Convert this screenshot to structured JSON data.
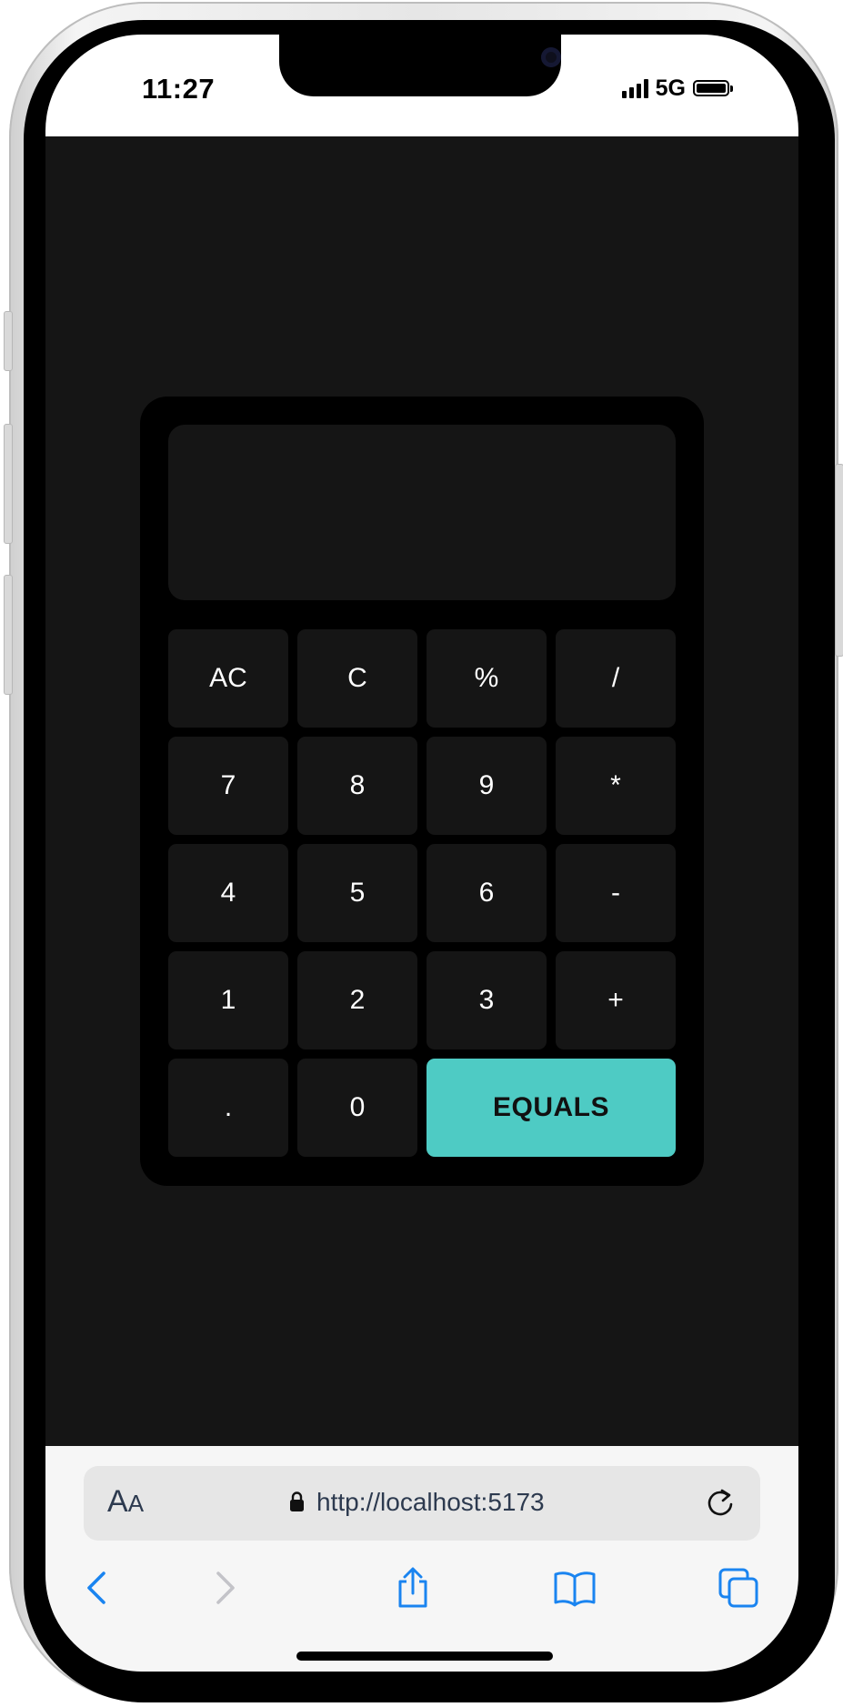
{
  "status_bar": {
    "time": "11:27",
    "network": "5G"
  },
  "calculator": {
    "display_value": "",
    "keys": [
      "AC",
      "C",
      "%",
      "/",
      "7",
      "8",
      "9",
      "*",
      "4",
      "5",
      "6",
      "-",
      "1",
      "2",
      "3",
      "+",
      ".",
      "0",
      "EQUALS"
    ],
    "accent_color": "#4ecbc4"
  },
  "browser": {
    "text_size_label": "AA",
    "url": "http://localhost:5173"
  },
  "icons": {
    "back": "chevron-left-icon",
    "forward": "chevron-right-icon",
    "share": "share-icon",
    "bookmarks": "book-icon",
    "tabs": "tabs-icon",
    "lock": "lock-icon",
    "reload": "reload-icon"
  }
}
